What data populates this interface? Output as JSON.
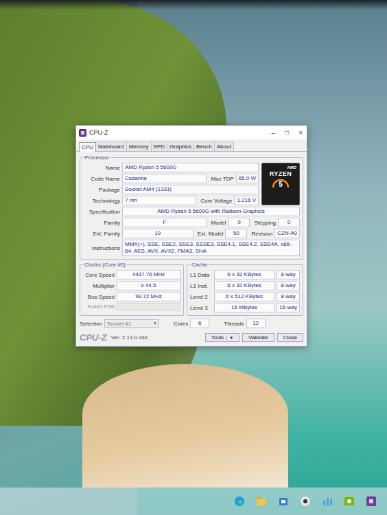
{
  "window": {
    "title": "CPU-Z",
    "controls": [
      "–",
      "□",
      "×"
    ]
  },
  "tabs": [
    {
      "label": "CPU",
      "selected": true
    },
    {
      "label": "Mainboard",
      "selected": false
    },
    {
      "label": "Memory",
      "selected": false
    },
    {
      "label": "SPD",
      "selected": false
    },
    {
      "label": "Graphics",
      "selected": false
    },
    {
      "label": "Bench",
      "selected": false
    },
    {
      "label": "About",
      "selected": false
    }
  ],
  "processor": {
    "title": "Processor",
    "top_rows": [
      {
        "cells": [
          {
            "label": "Name",
            "value": "AMD Ryzen 5 5600G"
          }
        ]
      },
      {
        "cells": [
          {
            "label": "Code Name",
            "value": "Cezanne"
          },
          {
            "label": "Max TDP",
            "value": "65.0 W"
          }
        ]
      },
      {
        "cells": [
          {
            "label": "Package",
            "value": "Socket AM4 (1331)"
          }
        ]
      },
      {
        "cells": [
          {
            "label": "Technology",
            "value": "7 nm"
          },
          {
            "label": "Core Voltage",
            "value": "1.216 V"
          }
        ]
      }
    ],
    "logo": {
      "brand": "AMD",
      "line": "RYZEN",
      "tier": "5"
    },
    "rows": [
      {
        "cells": [
          {
            "label": "Specification",
            "value": "AMD Ryzen 5 5600G with Radeon Graphics"
          }
        ]
      },
      {
        "cells": [
          {
            "label": "Family",
            "value": "F"
          },
          {
            "label": "Model",
            "value": "0"
          },
          {
            "label": "Stepping",
            "value": "0"
          }
        ]
      },
      {
        "cells": [
          {
            "label": "Ext. Family",
            "value": "19"
          },
          {
            "label": "Ext. Model",
            "value": "50"
          },
          {
            "label": "Revision",
            "value": "CZN-A0"
          }
        ]
      },
      {
        "cells": [
          {
            "label": "Instructions",
            "value": "MMX(+), SSE, SSE2, SSE3, SSSE3, SSE4.1, SSE4.2, SSE4A, x86-64, AES, AVX, AVX2, FMA3, SHA"
          }
        ]
      }
    ]
  },
  "clocks": {
    "title": "Clocks (Core #0)",
    "rows": [
      {
        "label": "Core Speed",
        "value": "4437.76 MHz",
        "disabled": false
      },
      {
        "label": "Multiplier",
        "value": "x 44.5",
        "disabled": false
      },
      {
        "label": "Bus Speed",
        "value": "99.72 MHz",
        "disabled": false
      },
      {
        "label": "Rated FSB",
        "value": "",
        "disabled": true
      }
    ]
  },
  "cache": {
    "title": "Cache",
    "rows": [
      {
        "label": "L1 Data",
        "value": "6 x 32 KBytes",
        "ways": "8-way"
      },
      {
        "label": "L1 Inst.",
        "value": "6 x 32 KBytes",
        "ways": "8-way"
      },
      {
        "label": "Level 2",
        "value": "6 x 512 KBytes",
        "ways": "8-way"
      },
      {
        "label": "Level 3",
        "value": "16 MBytes",
        "ways": "16-way"
      }
    ]
  },
  "selection": {
    "label": "Selection",
    "value": "Socket #1",
    "arrow": "▼",
    "disabled": true
  },
  "cores": {
    "label": "Cores",
    "value": "6"
  },
  "threads": {
    "label": "Threads",
    "value": "12"
  },
  "footer": {
    "brand": "CPU-Z",
    "version": "Ver. 2.13.0.x64",
    "buttons": [
      {
        "label": "Tools",
        "arrow": "▼"
      },
      {
        "label": "Validate",
        "arrow": ""
      },
      {
        "label": "Close",
        "arrow": ""
      }
    ]
  }
}
